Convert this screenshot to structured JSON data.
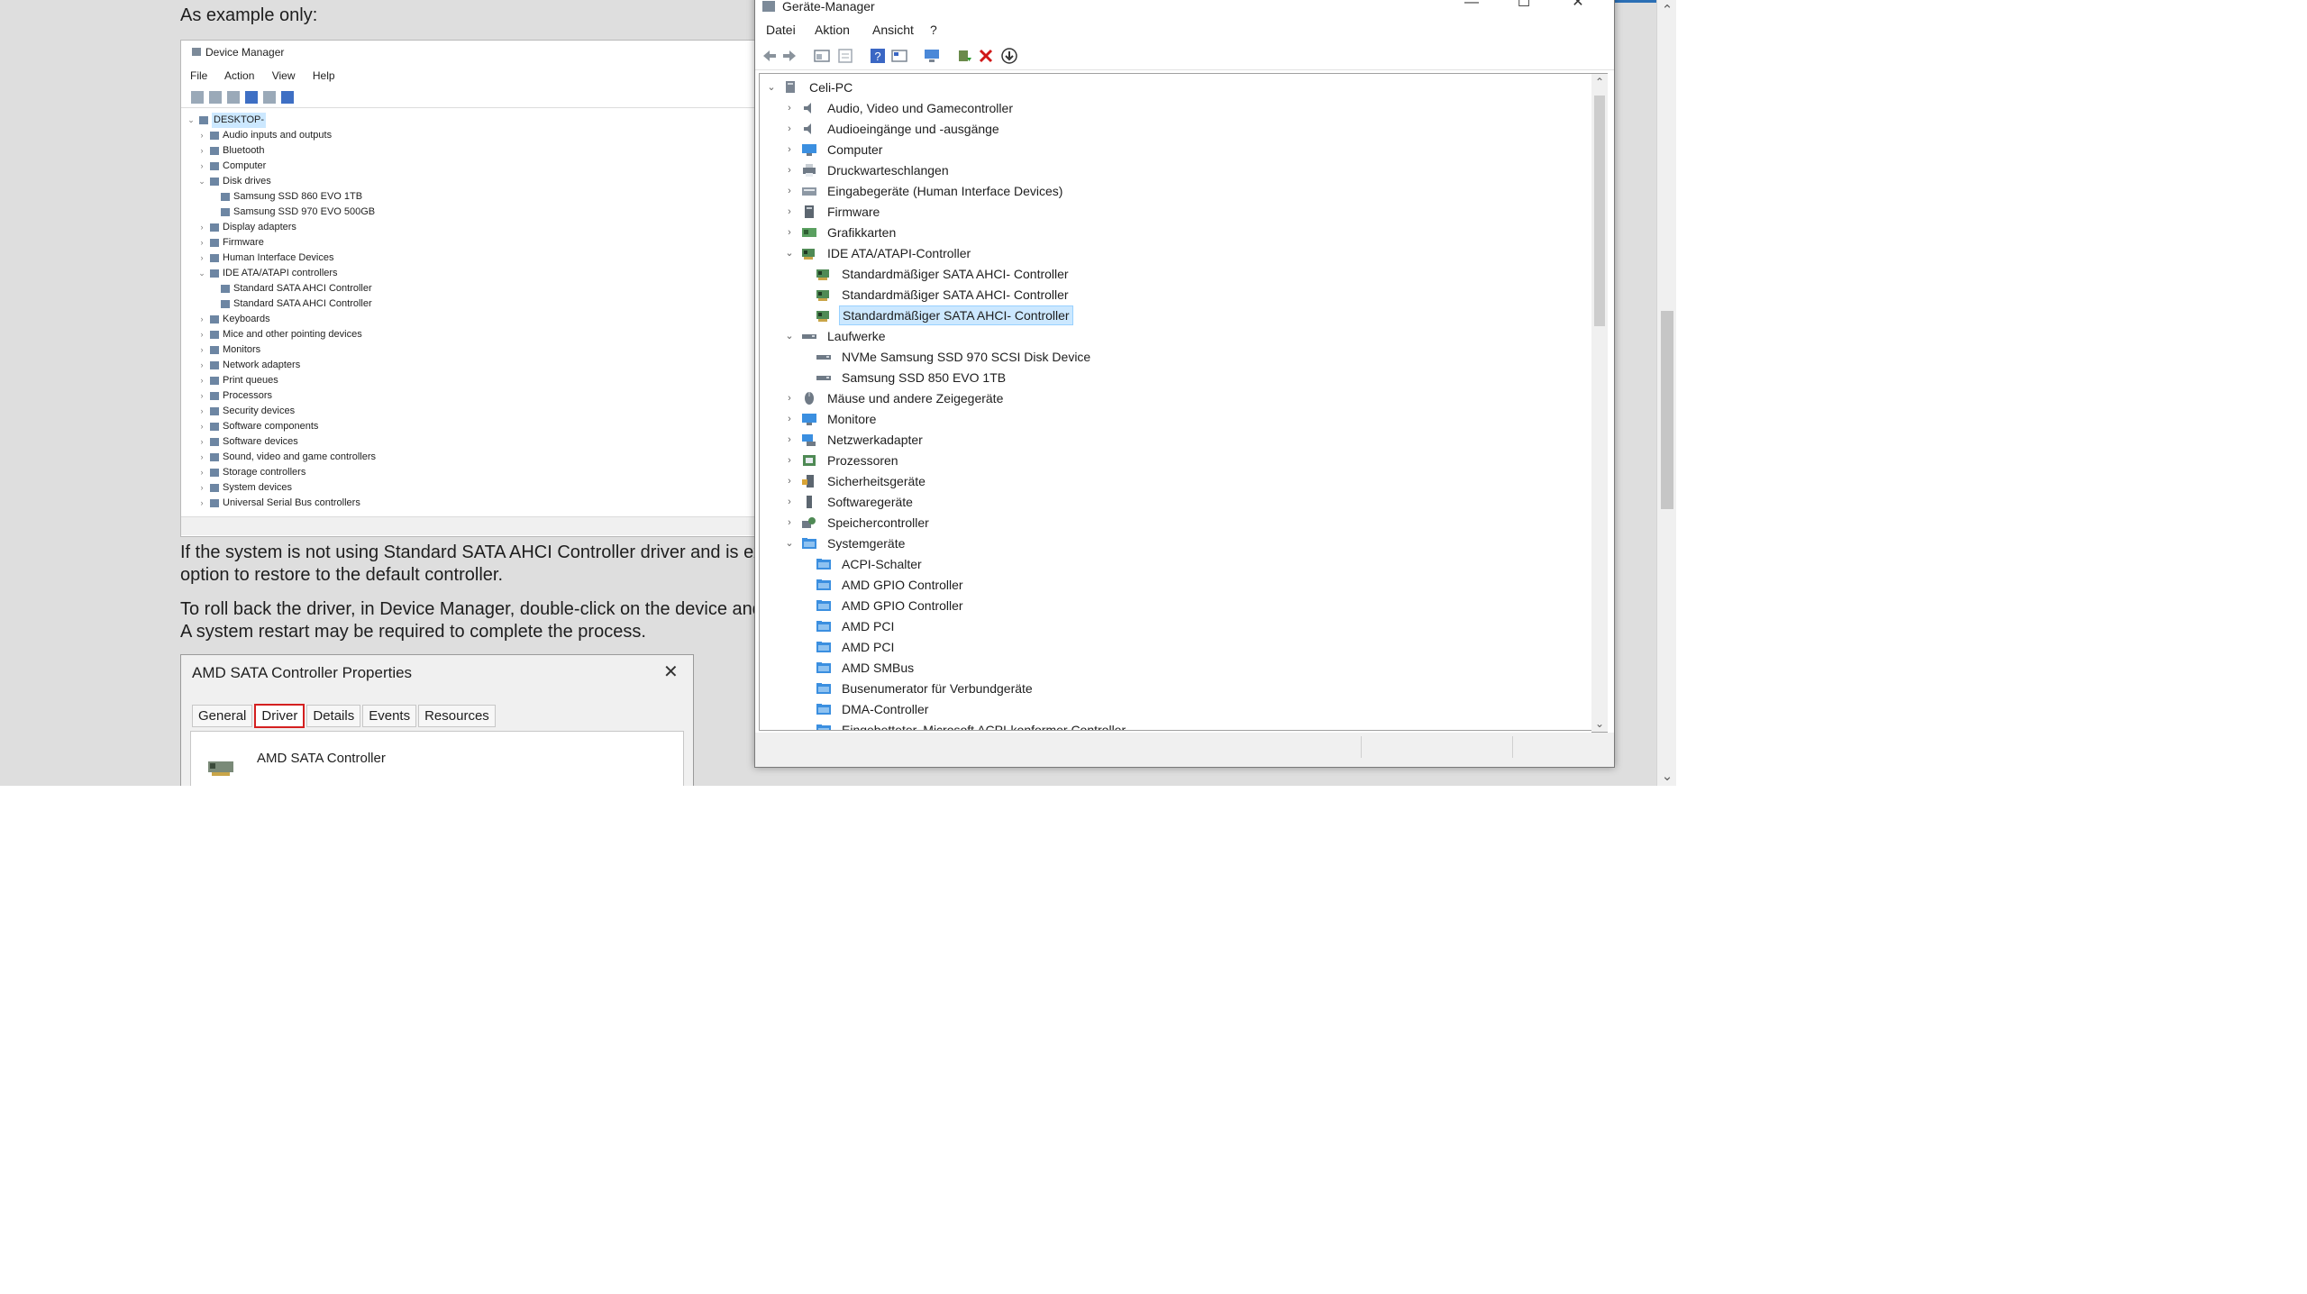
{
  "article": {
    "example_note": "As example only:",
    "para1_line1": "If the system is not using Standard SATA AHCI Controller driver and is experie",
    "para1_line2": "option to restore to the default controller.",
    "para2_line1": "To roll back the driver, in Device Manager, double-click on the device and sele",
    "para2_line2": "A system restart may be required to complete the process."
  },
  "example_window": {
    "title": "Device Manager",
    "menu": [
      "File",
      "Action",
      "View",
      "Help"
    ],
    "root": "DESKTOP-",
    "tree": [
      {
        "label": "Audio inputs and outputs",
        "expanded": false,
        "level": 1
      },
      {
        "label": "Bluetooth",
        "expanded": false,
        "level": 1
      },
      {
        "label": "Computer",
        "expanded": false,
        "level": 1
      },
      {
        "label": "Disk drives",
        "expanded": true,
        "level": 1
      },
      {
        "label": "Samsung SSD 860 EVO 1TB",
        "level": 2
      },
      {
        "label": "Samsung SSD 970 EVO 500GB",
        "level": 2
      },
      {
        "label": "Display adapters",
        "expanded": false,
        "level": 1
      },
      {
        "label": "Firmware",
        "expanded": false,
        "level": 1
      },
      {
        "label": "Human Interface Devices",
        "expanded": false,
        "level": 1
      },
      {
        "label": "IDE ATA/ATAPI controllers",
        "expanded": true,
        "level": 1
      },
      {
        "label": "Standard SATA AHCI Controller",
        "level": 2
      },
      {
        "label": "Standard SATA AHCI Controller",
        "level": 2
      },
      {
        "label": "Keyboards",
        "expanded": false,
        "level": 1
      },
      {
        "label": "Mice and other pointing devices",
        "expanded": false,
        "level": 1
      },
      {
        "label": "Monitors",
        "expanded": false,
        "level": 1
      },
      {
        "label": "Network adapters",
        "expanded": false,
        "level": 1
      },
      {
        "label": "Print queues",
        "expanded": false,
        "level": 1
      },
      {
        "label": "Processors",
        "expanded": false,
        "level": 1
      },
      {
        "label": "Security devices",
        "expanded": false,
        "level": 1
      },
      {
        "label": "Software components",
        "expanded": false,
        "level": 1
      },
      {
        "label": "Software devices",
        "expanded": false,
        "level": 1
      },
      {
        "label": "Sound, video and game controllers",
        "expanded": false,
        "level": 1
      },
      {
        "label": "Storage controllers",
        "expanded": false,
        "level": 1
      },
      {
        "label": "System devices",
        "expanded": false,
        "level": 1
      },
      {
        "label": "Universal Serial Bus controllers",
        "expanded": false,
        "level": 1
      }
    ]
  },
  "properties_dialog": {
    "title": "AMD SATA Controller Properties",
    "close_glyph": "✕",
    "tabs": [
      "General",
      "Driver",
      "Details",
      "Events",
      "Resources"
    ],
    "active_tab": "Driver",
    "device_name": "AMD SATA Controller"
  },
  "device_manager": {
    "title": "Geräte-Manager",
    "window_buttons": {
      "minimize": "—",
      "maximize": "☐",
      "close": "✕"
    },
    "menu": [
      "Datei",
      "Aktion",
      "Ansicht",
      "?"
    ],
    "root": "Celi-PC",
    "tree": [
      {
        "label": "Audio, Video und Gamecontroller",
        "expanded": false,
        "level": 1,
        "icon": "speaker-icon"
      },
      {
        "label": "Audioeingänge und -ausgänge",
        "expanded": false,
        "level": 1,
        "icon": "speaker-icon"
      },
      {
        "label": "Computer",
        "expanded": false,
        "level": 1,
        "icon": "monitor-icon"
      },
      {
        "label": "Druckwarteschlangen",
        "expanded": false,
        "level": 1,
        "icon": "printer-icon"
      },
      {
        "label": "Eingabegeräte (Human Interface Devices)",
        "expanded": false,
        "level": 1,
        "icon": "hid-icon"
      },
      {
        "label": "Firmware",
        "expanded": false,
        "level": 1,
        "icon": "firmware-icon"
      },
      {
        "label": "Grafikkarten",
        "expanded": false,
        "level": 1,
        "icon": "display-adapter-icon"
      },
      {
        "label": "IDE ATA/ATAPI-Controller",
        "expanded": true,
        "level": 1,
        "icon": "controller-icon"
      },
      {
        "label": "Standardmäßiger SATA AHCI- Controller",
        "level": 2,
        "icon": "controller-icon"
      },
      {
        "label": "Standardmäßiger SATA AHCI- Controller",
        "level": 2,
        "icon": "controller-icon"
      },
      {
        "label": "Standardmäßiger SATA AHCI- Controller",
        "level": 2,
        "icon": "controller-icon",
        "selected": true
      },
      {
        "label": "Laufwerke",
        "expanded": true,
        "level": 1,
        "icon": "drive-icon"
      },
      {
        "label": "NVMe Samsung SSD 970 SCSI Disk Device",
        "level": 2,
        "icon": "drive-icon"
      },
      {
        "label": "Samsung SSD 850 EVO 1TB",
        "level": 2,
        "icon": "drive-icon"
      },
      {
        "label": "Mäuse und andere Zeigegeräte",
        "expanded": false,
        "level": 1,
        "icon": "mouse-icon"
      },
      {
        "label": "Monitore",
        "expanded": false,
        "level": 1,
        "icon": "monitor-icon"
      },
      {
        "label": "Netzwerkadapter",
        "expanded": false,
        "level": 1,
        "icon": "network-icon"
      },
      {
        "label": "Prozessoren",
        "expanded": false,
        "level": 1,
        "icon": "processor-icon"
      },
      {
        "label": "Sicherheitsgeräte",
        "expanded": false,
        "level": 1,
        "icon": "security-icon"
      },
      {
        "label": "Softwaregeräte",
        "expanded": false,
        "level": 1,
        "icon": "software-device-icon"
      },
      {
        "label": "Speichercontroller",
        "expanded": false,
        "level": 1,
        "icon": "storage-icon"
      },
      {
        "label": "Systemgeräte",
        "expanded": true,
        "level": 1,
        "icon": "system-folder-icon"
      },
      {
        "label": "ACPI-Schalter",
        "level": 2,
        "icon": "system-folder-icon"
      },
      {
        "label": "AMD GPIO Controller",
        "level": 2,
        "icon": "system-folder-icon"
      },
      {
        "label": "AMD GPIO Controller",
        "level": 2,
        "icon": "system-folder-icon"
      },
      {
        "label": "AMD PCI",
        "level": 2,
        "icon": "system-folder-icon"
      },
      {
        "label": "AMD PCI",
        "level": 2,
        "icon": "system-folder-icon"
      },
      {
        "label": "AMD SMBus",
        "level": 2,
        "icon": "system-folder-icon"
      },
      {
        "label": "Busenumerator für Verbundgeräte",
        "level": 2,
        "icon": "system-folder-icon"
      },
      {
        "label": "DMA-Controller",
        "level": 2,
        "icon": "system-folder-icon"
      },
      {
        "label": "Eingebetteter, Microsoft ACPI-konformer Controller",
        "level": 2,
        "icon": "system-folder-icon"
      }
    ]
  },
  "colors": {
    "selection": "#cce8ff",
    "highlight_box": "#d42020",
    "accent_blue": "#2b6fb5"
  }
}
